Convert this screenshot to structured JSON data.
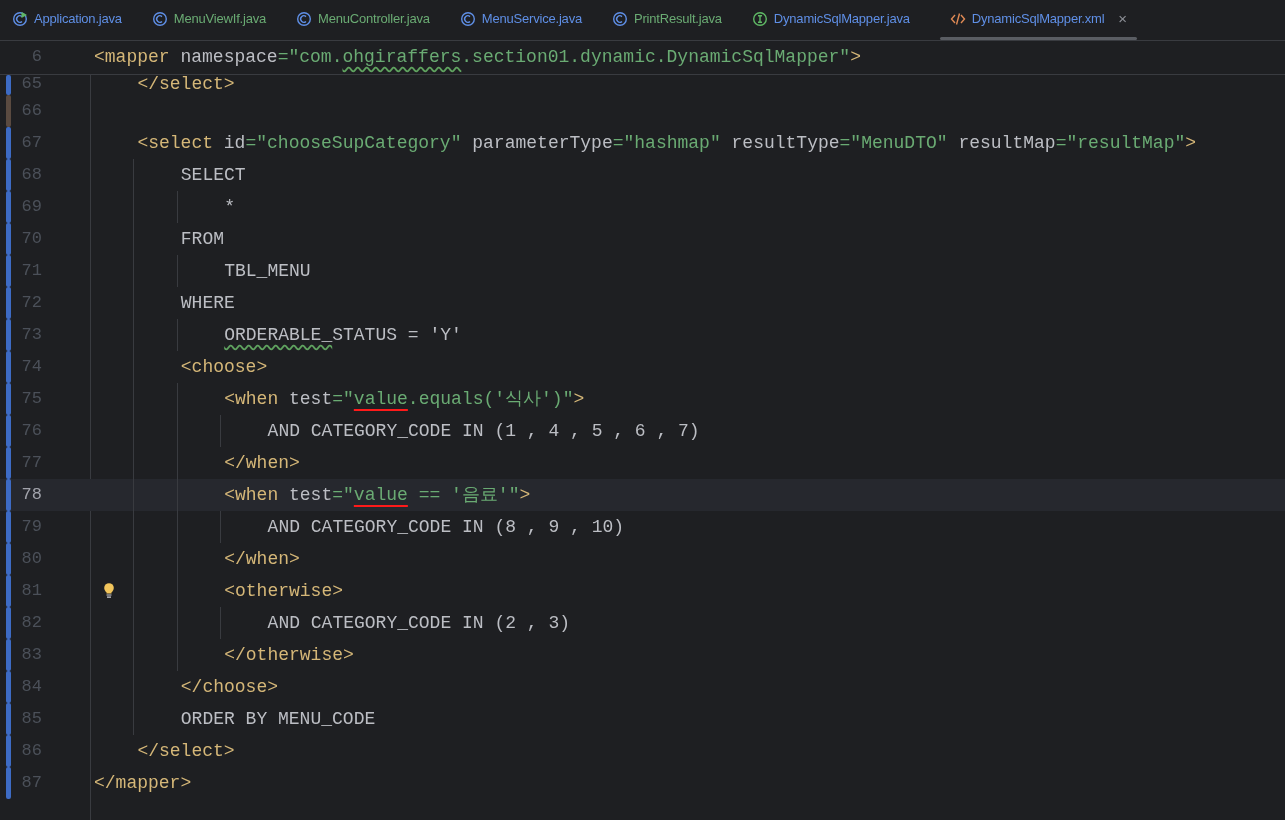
{
  "tabs": [
    {
      "label": "Application.java",
      "kind": "app",
      "color": "#5f8fe6",
      "selected": false
    },
    {
      "label": "MenuViewIf.java",
      "kind": "class",
      "color": "#6aab73",
      "selected": false
    },
    {
      "label": "MenuController.java",
      "kind": "class",
      "color": "#6aab73",
      "selected": false
    },
    {
      "label": "MenuService.java",
      "kind": "class",
      "color": "#5f8fe6",
      "selected": false
    },
    {
      "label": "PrintResult.java",
      "kind": "class",
      "color": "#6aab73",
      "selected": false
    },
    {
      "label": "DynamicSqlMapper.java",
      "kind": "interface",
      "color": "#5f8fe6",
      "selected": false
    },
    {
      "label": "DynamicSqlMapper.xml",
      "kind": "xml",
      "color": "#5f8fe6",
      "selected": true,
      "close": "×"
    }
  ],
  "editor": {
    "sticky_line": {
      "number": "6",
      "tokens": [
        {
          "kind": "tag",
          "text": "<mapper"
        },
        {
          "kind": "plain",
          "text": " namespace"
        },
        {
          "kind": "string",
          "text": "=\"com."
        },
        {
          "kind": "string_typo",
          "text": "ohgiraffers"
        },
        {
          "kind": "string",
          "text": ".section01.dynamic.DynamicSqlMapper\""
        },
        {
          "kind": "tag",
          "text": ">"
        }
      ],
      "children": [
        {
          "number": "65",
          "color": "#3d6bc4",
          "tokens": [
            {
              "kind": "tag",
              "text": "</select>"
            }
          ]
        },
        {
          "number": "66",
          "color": "#5a4a40"
        },
        {
          "number": "67",
          "color": "#3d6bc4",
          "tokens": [
            {
              "kind": "tag",
              "text": "<select"
            },
            {
              "kind": "plain",
              "text": " id"
            },
            {
              "kind": "string",
              "text": "=\"chooseSupCategory\""
            },
            {
              "kind": "plain",
              "text": " parameterType"
            },
            {
              "kind": "string",
              "text": "=\"hashmap\""
            },
            {
              "kind": "plain",
              "text": " resultType"
            },
            {
              "kind": "string",
              "text": "=\"MenuDTO\""
            },
            {
              "kind": "plain",
              "text": " resultMap"
            },
            {
              "kind": "string",
              "text": "=\"resultMap\""
            },
            {
              "kind": "tag",
              "text": ">"
            }
          ],
          "children": [
            {
              "number": "68",
              "color": "#3d6bc4",
              "tokens": [
                {
                  "kind": "plain",
                  "text": "SELECT"
                }
              ],
              "children": [
                {
                  "number": "69",
                  "color": "#3d6bc4",
                  "tokens": [
                    {
                      "kind": "plain",
                      "text": "*"
                    }
                  ]
                }
              ]
            },
            {
              "number": "70",
              "color": "#3d6bc4",
              "tokens": [
                {
                  "kind": "plain",
                  "text": "FROM"
                }
              ],
              "children": [
                {
                  "number": "71",
                  "color": "#3d6bc4",
                  "tokens": [
                    {
                      "kind": "plain",
                      "text": "TBL_MENU"
                    }
                  ]
                }
              ]
            },
            {
              "number": "72",
              "color": "#3d6bc4",
              "tokens": [
                {
                  "kind": "plain",
                  "text": "WHERE"
                }
              ],
              "children": [
                {
                  "number": "73",
                  "color": "#3d6bc4",
                  "tokens": [
                    {
                      "kind": "plain_typo",
                      "text": "ORDERABLE_"
                    },
                    {
                      "kind": "plain",
                      "text": "STATUS = 'Y'"
                    }
                  ]
                }
              ]
            },
            {
              "number": "74",
              "color": "#3d6bc4",
              "tokens": [
                {
                  "kind": "tag",
                  "text": "<choose>"
                }
              ],
              "children": [
                {
                  "number": "75",
                  "color": "#3d6bc4",
                  "tokens": [
                    {
                      "kind": "tag",
                      "text": "<when"
                    },
                    {
                      "kind": "plain",
                      "text": " test"
                    },
                    {
                      "kind": "string",
                      "text": "=\""
                    },
                    {
                      "kind": "string_marked",
                      "text": "value"
                    },
                    {
                      "kind": "string",
                      "text": ".equals('식사')\""
                    },
                    {
                      "kind": "tag",
                      "text": ">"
                    }
                  ],
                  "children": [
                    {
                      "number": "76",
                      "color": "#3d6bc4",
                      "tokens": [
                        {
                          "kind": "plain",
                          "text": "AND CATEGORY_CODE IN (1 , 4 , 5 , 6 , 7)"
                        }
                      ]
                    }
                  ]
                },
                {
                  "number": "77",
                  "color": "#3d6bc4",
                  "tokens": [
                    {
                      "kind": "tag",
                      "text": "</when>"
                    }
                  ]
                },
                {
                  "number": "78",
                  "color": "#3d6bc4",
                  "current": true,
                  "tokens": [
                    {
                      "kind": "tag",
                      "text": "<when"
                    },
                    {
                      "kind": "plain",
                      "text": " test"
                    },
                    {
                      "kind": "string",
                      "text": "=\""
                    },
                    {
                      "kind": "string_marked",
                      "text": "value"
                    },
                    {
                      "kind": "string",
                      "text": " == '음료'\""
                    },
                    {
                      "kind": "tag",
                      "text": ">"
                    }
                  ],
                  "children": [
                    {
                      "number": "79",
                      "color": "#3d6bc4",
                      "tokens": [
                        {
                          "kind": "plain",
                          "text": "AND CATEGORY_CODE IN (8 , 9 , 10)"
                        }
                      ]
                    }
                  ]
                },
                {
                  "number": "80",
                  "color": "#3d6bc4",
                  "tokens": [
                    {
                      "kind": "tag",
                      "text": "</when>"
                    }
                  ]
                },
                {
                  "number": "81",
                  "color": "#3d6bc4",
                  "bulb": true,
                  "tokens": [
                    {
                      "kind": "tag",
                      "text": "<otherwise>"
                    }
                  ],
                  "children": [
                    {
                      "number": "82",
                      "color": "#3d6bc4",
                      "tokens": [
                        {
                          "kind": "plain",
                          "text": "AND CATEGORY_CODE IN (2 , 3)"
                        }
                      ]
                    }
                  ]
                },
                {
                  "number": "83",
                  "color": "#3d6bc4",
                  "tokens": [
                    {
                      "kind": "tag",
                      "text": "</otherwise>"
                    }
                  ]
                }
              ]
            },
            {
              "number": "84",
              "color": "#3d6bc4",
              "tokens": [
                {
                  "kind": "tag",
                  "text": "</choose>"
                }
              ]
            },
            {
              "number": "85",
              "color": "#3d6bc4",
              "tokens": [
                {
                  "kind": "plain",
                  "text": "ORDER BY MENU_CODE"
                }
              ]
            }
          ]
        },
        {
          "number": "86",
          "color": "#3d6bc4",
          "tokens": [
            {
              "kind": "tag",
              "text": "</select>"
            }
          ]
        }
      ]
    },
    "lines_after": [
      {
        "number": "87",
        "color": "#3d6bc4",
        "tokens": [
          {
            "kind": "tag",
            "text": "</mapper>"
          }
        ]
      }
    ]
  }
}
